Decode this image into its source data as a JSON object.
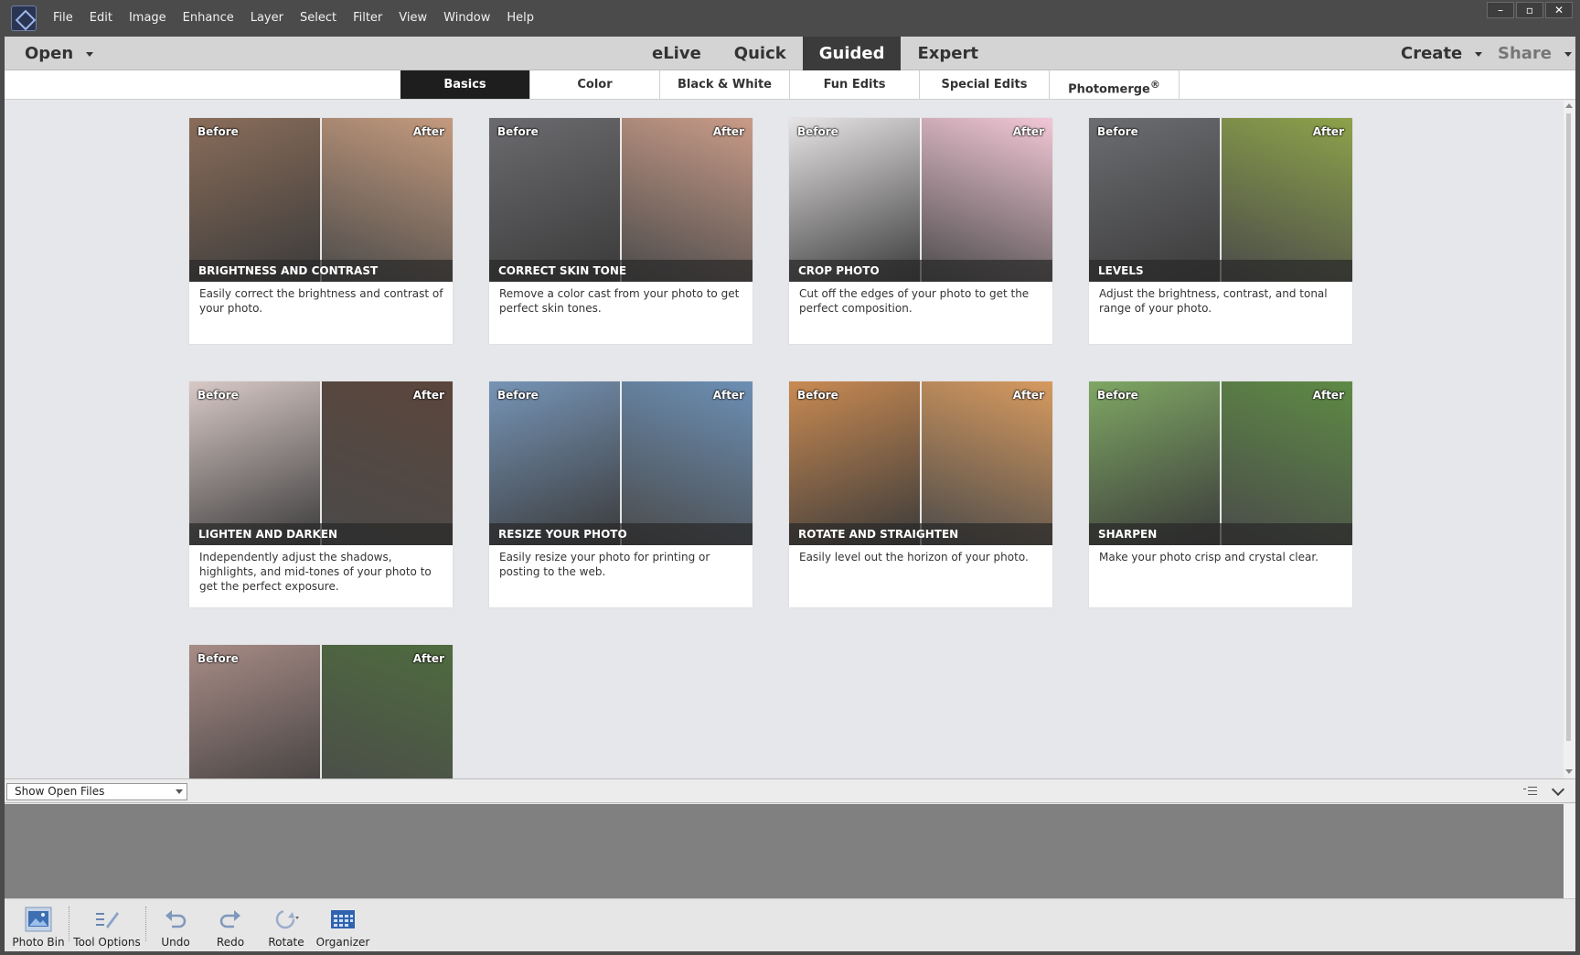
{
  "menu": [
    "File",
    "Edit",
    "Image",
    "Enhance",
    "Layer",
    "Select",
    "Filter",
    "View",
    "Window",
    "Help"
  ],
  "window_controls": {
    "minimize": "–",
    "restore": "▫",
    "close": "✕"
  },
  "modebar": {
    "open_label": "Open",
    "tabs": [
      "eLive",
      "Quick",
      "Guided",
      "Expert"
    ],
    "active_tab": "Guided",
    "create_label": "Create",
    "share_label": "Share"
  },
  "categories": {
    "tabs": [
      "Basics",
      "Color",
      "Black & White",
      "Fun Edits",
      "Special Edits",
      "Photomerge"
    ],
    "photomerge_mark": "®",
    "active": "Basics"
  },
  "cards": [
    {
      "before": "Before",
      "after": "After",
      "title": "BRIGHTNESS AND CONTRAST",
      "desc": "Easily correct the brightness and contrast of your photo.",
      "colors": [
        "#8a6d5a",
        "#c49a7d"
      ]
    },
    {
      "before": "Before",
      "after": "After",
      "title": "CORRECT SKIN TONE",
      "desc": "Remove a color cast from your photo to get perfect skin tones.",
      "colors": [
        "#6b6a6e",
        "#c99b88"
      ]
    },
    {
      "before": "Before",
      "after": "After",
      "title": "CROP PHOTO",
      "desc": "Cut off the edges of your photo to get the perfect composition.",
      "colors": [
        "#e7e4e6",
        "#f2c7d6"
      ]
    },
    {
      "before": "Before",
      "after": "After",
      "title": "LEVELS",
      "desc": "Adjust the brightness, contrast, and tonal range of your photo.",
      "colors": [
        "#6c6d71",
        "#8da24a"
      ]
    },
    {
      "before": "Before",
      "after": "After",
      "title": "LIGHTEN AND DARKEN",
      "desc": "Independently adjust the shadows, highlights, and mid-tones of your photo to get the perfect exposure.",
      "colors": [
        "#d8c9c6",
        "#5b463c"
      ]
    },
    {
      "before": "Before",
      "after": "After",
      "title": "RESIZE YOUR PHOTO",
      "desc": "Easily resize your photo for printing or posting to the web.",
      "colors": [
        "#7694b6",
        "#6c8fb4"
      ]
    },
    {
      "before": "Before",
      "after": "After",
      "title": "ROTATE AND STRAIGHTEN",
      "desc": "Easily level out the horizon of your photo.",
      "colors": [
        "#c98a52",
        "#d79a5f"
      ]
    },
    {
      "before": "Before",
      "after": "After",
      "title": "SHARPEN",
      "desc": "Make your photo crisp and crystal clear.",
      "colors": [
        "#7fa764",
        "#5e8a45"
      ]
    },
    {
      "before": "Before",
      "after": "After",
      "title": "",
      "desc": "",
      "colors": [
        "#a88c86",
        "#4f6b3f"
      ]
    }
  ],
  "binbar": {
    "select_value": "Show Open Files"
  },
  "taskbar": [
    "Photo Bin",
    "Tool Options",
    "Undo",
    "Redo",
    "Rotate",
    "Organizer"
  ]
}
